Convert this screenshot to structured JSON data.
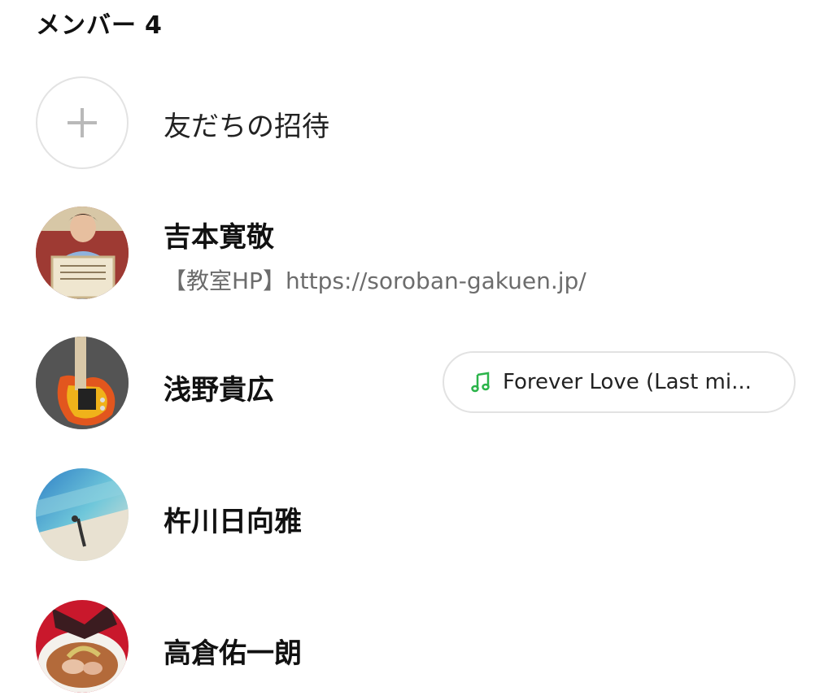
{
  "header": {
    "title": "メンバー",
    "count": "4"
  },
  "invite": {
    "label": "友だちの招待"
  },
  "members": [
    {
      "name": "吉本寛敬",
      "status": "【教室HP】https://soroban-gakuen.jp/"
    },
    {
      "name": "浅野貴広",
      "music": "Forever Love (Last mi..."
    },
    {
      "name": "杵川日向雅"
    },
    {
      "name": "高倉佑一朗"
    }
  ],
  "colors": {
    "music_icon": "#2bb44a",
    "status_text": "#6c6c6c"
  }
}
